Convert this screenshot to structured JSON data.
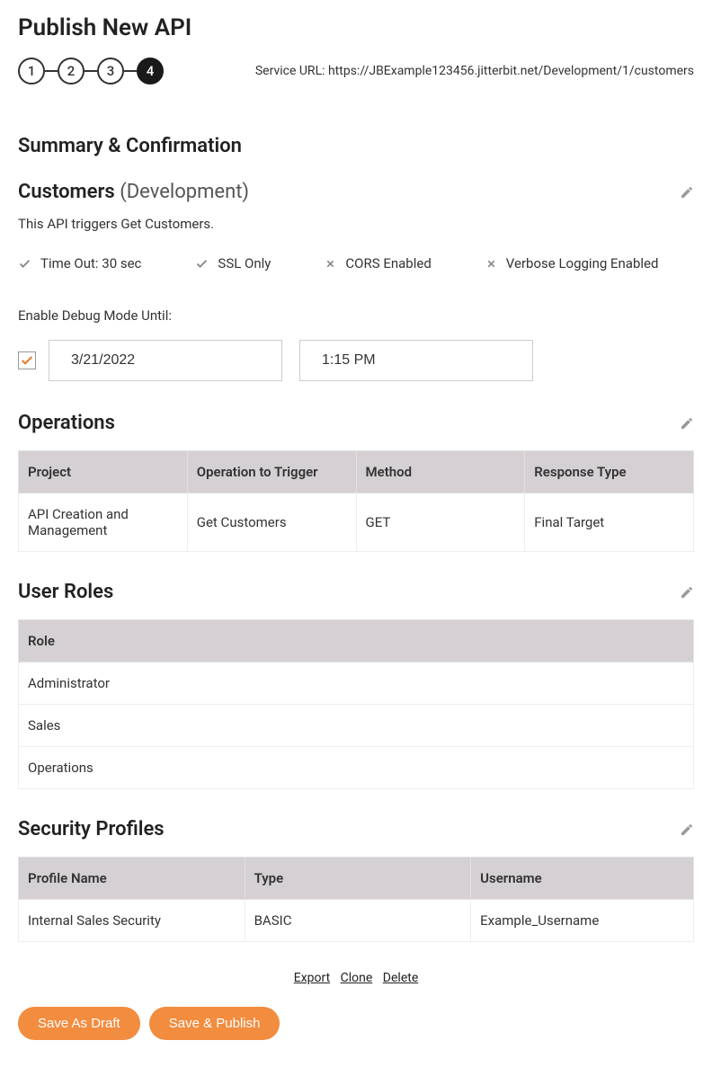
{
  "page_title": "Publish New API",
  "steps": [
    "1",
    "2",
    "3",
    "4"
  ],
  "active_step": 4,
  "service_url_label": "Service URL: ",
  "service_url": "https://JBExample123456.jitterbit.net/Development/1/customers",
  "section_title": "Summary & Confirmation",
  "api": {
    "name": "Customers",
    "env": "(Development)",
    "description": "This API triggers Get Customers."
  },
  "flags": {
    "timeout": {
      "enabled": true,
      "label": "Time Out: 30 sec"
    },
    "ssl": {
      "enabled": true,
      "label": "SSL Only"
    },
    "cors": {
      "enabled": false,
      "label": "CORS Enabled"
    },
    "verbose": {
      "enabled": false,
      "label": "Verbose Logging Enabled"
    }
  },
  "debug": {
    "label": "Enable Debug Mode Until:",
    "enabled": true,
    "date": "3/21/2022",
    "time": "1:15 PM"
  },
  "operations": {
    "title": "Operations",
    "headers": {
      "project": "Project",
      "operation": "Operation to Trigger",
      "method": "Method",
      "response": "Response Type"
    },
    "row": {
      "project": "API Creation and Management",
      "operation": "Get Customers",
      "method": "GET",
      "response": "Final Target"
    }
  },
  "user_roles": {
    "title": "User Roles",
    "header": "Role",
    "rows": [
      "Administrator",
      "Sales",
      "Operations"
    ]
  },
  "security": {
    "title": "Security Profiles",
    "headers": {
      "profile": "Profile Name",
      "type": "Type",
      "username": "Username"
    },
    "row": {
      "profile": "Internal Sales Security",
      "type": "BASIC",
      "username": "Example_Username"
    }
  },
  "actions": {
    "export": "Export",
    "clone": "Clone",
    "delete": "Delete"
  },
  "buttons": {
    "draft": "Save As Draft",
    "publish": "Save & Publish"
  }
}
